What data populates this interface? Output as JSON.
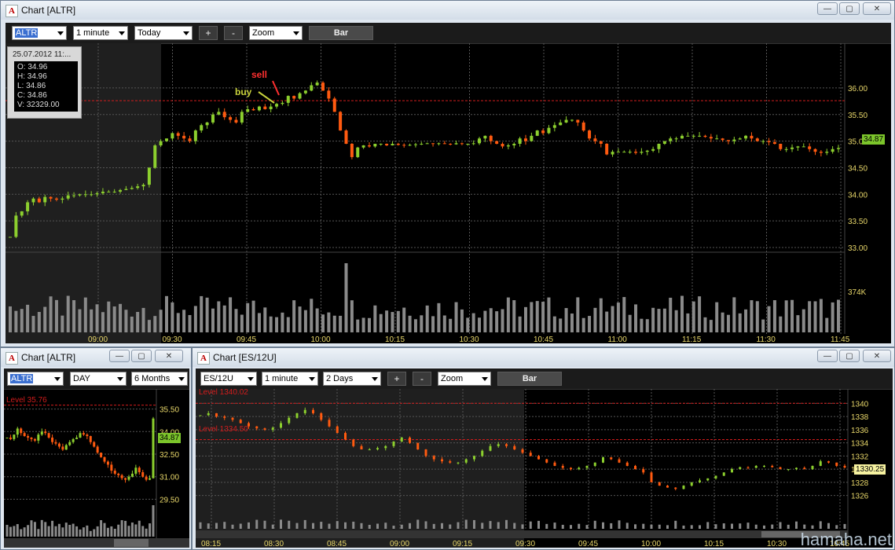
{
  "colors": {
    "up": "#8ccf2e",
    "down": "#ff5a10",
    "grid": "#555555",
    "level": "#d21c1c",
    "axis": "#e8d76a",
    "volume": "#8a8a8a"
  },
  "win1": {
    "title": "Chart [ALTR]",
    "symbol": "ALTR",
    "interval": "1 minute",
    "range": "Today",
    "zoom": "Zoom",
    "plus": "+",
    "minus": "-",
    "mode": "Bar",
    "tooltip": {
      "date": "25.07.2012 11:...",
      "o": "O: 34.96",
      "h": "H: 34.96",
      "l": "L: 34.86",
      "c": "C: 34.86",
      "v": "V: 32329.00"
    },
    "annot": {
      "buy": "buy",
      "sell": "sell"
    },
    "last": "34.87",
    "volume_label": "374K"
  },
  "win2": {
    "title": "Chart [ALTR]",
    "symbol": "ALTR",
    "interval": "DAY",
    "range": "6 Months",
    "level_label": "Level 35.76",
    "last": "34.87"
  },
  "win3": {
    "title": "Chart [ES/12U]",
    "symbol": "ES/12U",
    "interval": "1 minute",
    "range": "2 Days",
    "zoom": "Zoom",
    "plus": "+",
    "minus": "-",
    "mode": "Bar",
    "level1": "Level 1340.02",
    "level2": "Level 1334.50",
    "last": "1330.25"
  },
  "watermark": "hamaha.net",
  "chart_data": [
    {
      "type": "candlestick",
      "title": "Chart [ALTR]",
      "interval": "1 minute",
      "x_ticks": [
        "09:00",
        "09:30",
        "09:45",
        "10:00",
        "10:15",
        "10:30",
        "10:45",
        "11:00",
        "11:15",
        "11:30",
        "11:45"
      ],
      "y_ticks": [
        33.0,
        33.5,
        34.0,
        34.5,
        35.0,
        35.5,
        36.0
      ],
      "ylim": [
        33.0,
        36.25
      ],
      "level": 35.76,
      "annotations": [
        {
          "text": "buy",
          "x": "09:50"
        },
        {
          "text": "sell",
          "x": "09:56"
        }
      ],
      "close_series": [
        33.2,
        33.6,
        33.68,
        33.85,
        33.92,
        33.85,
        33.95,
        33.92,
        33.9,
        33.92,
        33.98,
        33.98,
        34.0,
        34.0,
        34.0,
        34.02,
        34.05,
        34.05,
        34.05,
        34.08,
        34.1,
        34.12,
        34.15,
        34.18,
        34.5,
        34.92,
        35.0,
        35.05,
        35.15,
        35.1,
        35.05,
        35.0,
        35.2,
        35.3,
        35.35,
        35.5,
        35.55,
        35.45,
        35.4,
        35.35,
        35.55,
        35.6,
        35.58,
        35.65,
        35.6,
        35.65,
        35.7,
        35.72,
        35.85,
        35.8,
        35.9,
        35.95,
        36.05,
        36.1,
        35.95,
        35.8,
        35.55,
        35.2,
        34.95,
        34.7,
        34.88,
        34.92,
        34.9,
        34.95,
        34.95,
        34.92,
        34.95,
        34.93,
        34.92,
        34.93,
        34.94,
        34.95,
        34.96,
        34.95,
        34.96,
        34.95,
        34.94,
        34.96,
        34.95,
        34.95,
        34.96,
        35.05,
        35.1,
        35.0,
        34.95,
        34.9,
        34.92,
        34.95,
        35.05,
        35.0,
        35.1,
        35.2,
        35.15,
        35.25,
        35.3,
        35.35,
        35.4,
        35.4,
        35.35,
        35.2,
        35.05,
        35.0,
        34.95,
        34.75,
        34.8,
        34.8,
        34.8,
        34.8,
        34.78,
        34.8,
        34.82,
        34.85,
        34.95,
        35.0,
        35.05,
        35.05,
        35.1,
        35.1,
        35.1,
        35.1,
        35.08,
        35.05,
        35.05,
        35.02,
        35.0,
        35.03,
        35.05,
        35.1,
        35.05,
        35.0,
        35.0,
        34.98,
        34.95,
        34.85,
        34.85,
        34.88,
        34.9,
        34.9,
        34.85,
        34.8,
        34.78,
        34.8,
        34.85,
        34.87
      ],
      "volume_label": "374K"
    },
    {
      "type": "candlestick",
      "title": "Chart [ALTR]",
      "interval": "DAY",
      "y_ticks": [
        29.5,
        31.0,
        32.5,
        34.0,
        35.5
      ],
      "ylim": [
        29.0,
        36.0
      ],
      "level": 35.76,
      "close_series": [
        33.6,
        33.5,
        33.8,
        34.2,
        33.9,
        33.7,
        33.6,
        33.5,
        33.4,
        33.8,
        34.0,
        33.9,
        33.6,
        33.3,
        33.2,
        33.0,
        32.8,
        33.1,
        33.3,
        33.5,
        33.6,
        33.9,
        33.8,
        33.7,
        33.3,
        33.0,
        32.6,
        32.3,
        32.0,
        31.8,
        31.4,
        31.2,
        31.1,
        30.9,
        30.8,
        31.0,
        31.2,
        31.6,
        31.3,
        31.0,
        30.8,
        30.9,
        34.87
      ]
    },
    {
      "type": "candlestick",
      "title": "Chart [ES/12U]",
      "interval": "1 minute",
      "x_ticks": [
        "08:15",
        "08:30",
        "08:45",
        "09:00",
        "09:15",
        "09:30",
        "09:45",
        "10:00",
        "10:15",
        "10:30",
        "10:45"
      ],
      "y_ticks": [
        1326,
        1328,
        1330,
        1332,
        1334,
        1336,
        1338,
        1340
      ],
      "ylim": [
        1325.0,
        1341.0
      ],
      "levels": [
        1340.02,
        1334.5
      ],
      "close_series": [
        1338.2,
        1338.5,
        1338.0,
        1337.8,
        1337.5,
        1337.0,
        1336.5,
        1336.2,
        1336.0,
        1336.3,
        1337.0,
        1337.8,
        1338.5,
        1339.0,
        1338.5,
        1337.5,
        1336.5,
        1335.5,
        1334.5,
        1333.5,
        1333.0,
        1333.0,
        1333.2,
        1333.5,
        1334.2,
        1334.8,
        1334.0,
        1333.0,
        1332.0,
        1331.5,
        1331.2,
        1331.0,
        1331.0,
        1331.5,
        1332.0,
        1332.8,
        1333.5,
        1333.8,
        1333.5,
        1333.0,
        1332.5,
        1332.0,
        1331.5,
        1331.0,
        1330.5,
        1330.2,
        1330.0,
        1330.2,
        1330.5,
        1331.0,
        1331.8,
        1331.5,
        1331.0,
        1330.5,
        1330.0,
        1329.5,
        1328.0,
        1327.5,
        1327.2,
        1327.0,
        1327.5,
        1328.0,
        1328.3,
        1328.6,
        1329.0,
        1329.5,
        1330.0,
        1330.3,
        1330.2,
        1330.5,
        1330.5,
        1330.3,
        1330.0,
        1330.0,
        1330.2,
        1330.0,
        1330.5,
        1331.2,
        1331.0,
        1330.5,
        1330.25
      ]
    }
  ]
}
